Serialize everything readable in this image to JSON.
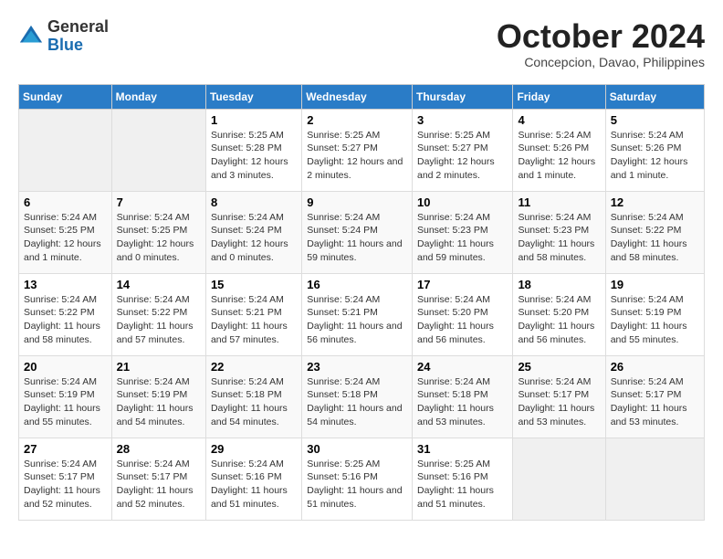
{
  "header": {
    "logo_general": "General",
    "logo_blue": "Blue",
    "month_title": "October 2024",
    "subtitle": "Concepcion, Davao, Philippines"
  },
  "weekdays": [
    "Sunday",
    "Monday",
    "Tuesday",
    "Wednesday",
    "Thursday",
    "Friday",
    "Saturday"
  ],
  "weeks": [
    [
      {
        "day": "",
        "info": ""
      },
      {
        "day": "",
        "info": ""
      },
      {
        "day": "1",
        "info": "Sunrise: 5:25 AM\nSunset: 5:28 PM\nDaylight: 12 hours and 3 minutes."
      },
      {
        "day": "2",
        "info": "Sunrise: 5:25 AM\nSunset: 5:27 PM\nDaylight: 12 hours and 2 minutes."
      },
      {
        "day": "3",
        "info": "Sunrise: 5:25 AM\nSunset: 5:27 PM\nDaylight: 12 hours and 2 minutes."
      },
      {
        "day": "4",
        "info": "Sunrise: 5:24 AM\nSunset: 5:26 PM\nDaylight: 12 hours and 1 minute."
      },
      {
        "day": "5",
        "info": "Sunrise: 5:24 AM\nSunset: 5:26 PM\nDaylight: 12 hours and 1 minute."
      }
    ],
    [
      {
        "day": "6",
        "info": "Sunrise: 5:24 AM\nSunset: 5:25 PM\nDaylight: 12 hours and 1 minute."
      },
      {
        "day": "7",
        "info": "Sunrise: 5:24 AM\nSunset: 5:25 PM\nDaylight: 12 hours and 0 minutes."
      },
      {
        "day": "8",
        "info": "Sunrise: 5:24 AM\nSunset: 5:24 PM\nDaylight: 12 hours and 0 minutes."
      },
      {
        "day": "9",
        "info": "Sunrise: 5:24 AM\nSunset: 5:24 PM\nDaylight: 11 hours and 59 minutes."
      },
      {
        "day": "10",
        "info": "Sunrise: 5:24 AM\nSunset: 5:23 PM\nDaylight: 11 hours and 59 minutes."
      },
      {
        "day": "11",
        "info": "Sunrise: 5:24 AM\nSunset: 5:23 PM\nDaylight: 11 hours and 58 minutes."
      },
      {
        "day": "12",
        "info": "Sunrise: 5:24 AM\nSunset: 5:22 PM\nDaylight: 11 hours and 58 minutes."
      }
    ],
    [
      {
        "day": "13",
        "info": "Sunrise: 5:24 AM\nSunset: 5:22 PM\nDaylight: 11 hours and 58 minutes."
      },
      {
        "day": "14",
        "info": "Sunrise: 5:24 AM\nSunset: 5:22 PM\nDaylight: 11 hours and 57 minutes."
      },
      {
        "day": "15",
        "info": "Sunrise: 5:24 AM\nSunset: 5:21 PM\nDaylight: 11 hours and 57 minutes."
      },
      {
        "day": "16",
        "info": "Sunrise: 5:24 AM\nSunset: 5:21 PM\nDaylight: 11 hours and 56 minutes."
      },
      {
        "day": "17",
        "info": "Sunrise: 5:24 AM\nSunset: 5:20 PM\nDaylight: 11 hours and 56 minutes."
      },
      {
        "day": "18",
        "info": "Sunrise: 5:24 AM\nSunset: 5:20 PM\nDaylight: 11 hours and 56 minutes."
      },
      {
        "day": "19",
        "info": "Sunrise: 5:24 AM\nSunset: 5:19 PM\nDaylight: 11 hours and 55 minutes."
      }
    ],
    [
      {
        "day": "20",
        "info": "Sunrise: 5:24 AM\nSunset: 5:19 PM\nDaylight: 11 hours and 55 minutes."
      },
      {
        "day": "21",
        "info": "Sunrise: 5:24 AM\nSunset: 5:19 PM\nDaylight: 11 hours and 54 minutes."
      },
      {
        "day": "22",
        "info": "Sunrise: 5:24 AM\nSunset: 5:18 PM\nDaylight: 11 hours and 54 minutes."
      },
      {
        "day": "23",
        "info": "Sunrise: 5:24 AM\nSunset: 5:18 PM\nDaylight: 11 hours and 54 minutes."
      },
      {
        "day": "24",
        "info": "Sunrise: 5:24 AM\nSunset: 5:18 PM\nDaylight: 11 hours and 53 minutes."
      },
      {
        "day": "25",
        "info": "Sunrise: 5:24 AM\nSunset: 5:17 PM\nDaylight: 11 hours and 53 minutes."
      },
      {
        "day": "26",
        "info": "Sunrise: 5:24 AM\nSunset: 5:17 PM\nDaylight: 11 hours and 53 minutes."
      }
    ],
    [
      {
        "day": "27",
        "info": "Sunrise: 5:24 AM\nSunset: 5:17 PM\nDaylight: 11 hours and 52 minutes."
      },
      {
        "day": "28",
        "info": "Sunrise: 5:24 AM\nSunset: 5:17 PM\nDaylight: 11 hours and 52 minutes."
      },
      {
        "day": "29",
        "info": "Sunrise: 5:24 AM\nSunset: 5:16 PM\nDaylight: 11 hours and 51 minutes."
      },
      {
        "day": "30",
        "info": "Sunrise: 5:25 AM\nSunset: 5:16 PM\nDaylight: 11 hours and 51 minutes."
      },
      {
        "day": "31",
        "info": "Sunrise: 5:25 AM\nSunset: 5:16 PM\nDaylight: 11 hours and 51 minutes."
      },
      {
        "day": "",
        "info": ""
      },
      {
        "day": "",
        "info": ""
      }
    ]
  ]
}
